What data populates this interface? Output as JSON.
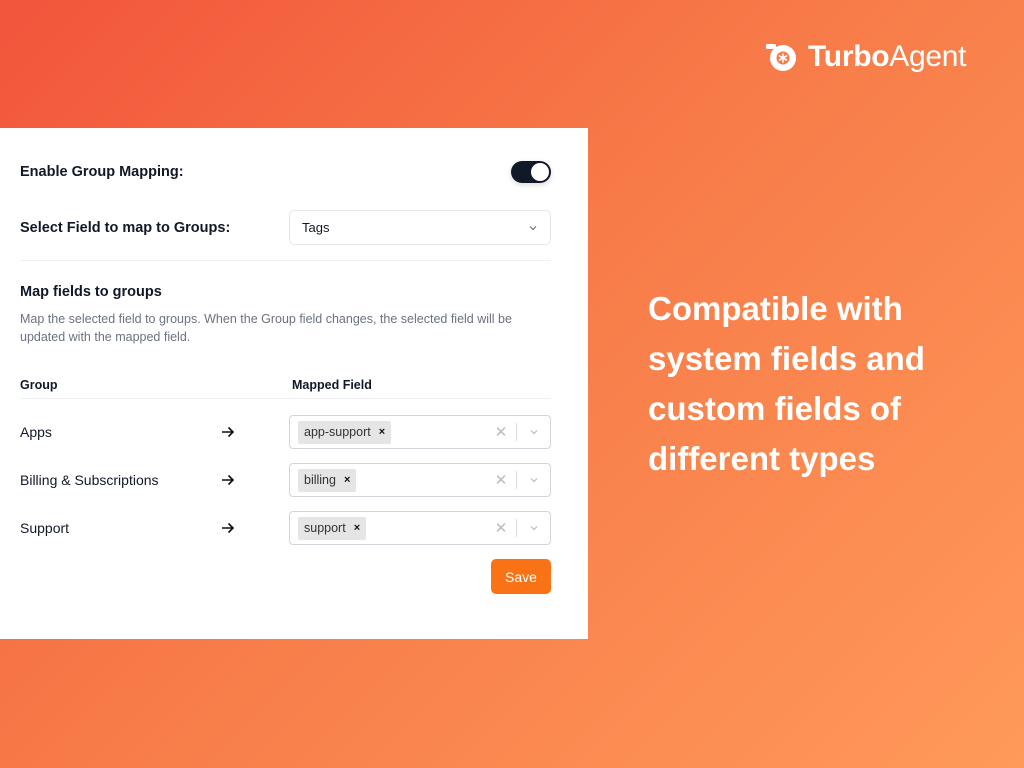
{
  "brand": {
    "logo_icon": "turbo-logo-icon",
    "name_bold": "Turbo",
    "name_regular": "Agent"
  },
  "settings": {
    "enable_label": "Enable Group Mapping:",
    "enable_toggle_on": true,
    "select_field_label": "Select Field to map to Groups:",
    "select_field_value": "Tags",
    "section_title": "Map fields to groups",
    "section_description": "Map the selected field to groups. When the Group field changes, the selected field will be updated with the mapped field.",
    "table_headers": {
      "group": "Group",
      "mapped_field": "Mapped Field"
    },
    "rows": [
      {
        "group": "Apps",
        "tag": "app-support"
      },
      {
        "group": "Billing & Subscriptions",
        "tag": "billing"
      },
      {
        "group": "Support",
        "tag": "support"
      }
    ],
    "chip_remove": "×",
    "clear_icon": "✕",
    "save_label": "Save"
  },
  "headline": "Compatible with system fields and custom fields of different types",
  "colors": {
    "accent": "#f97316",
    "toggle_on": "#111827",
    "background_start": "#f2553b",
    "background_end": "#ff9a5a"
  }
}
